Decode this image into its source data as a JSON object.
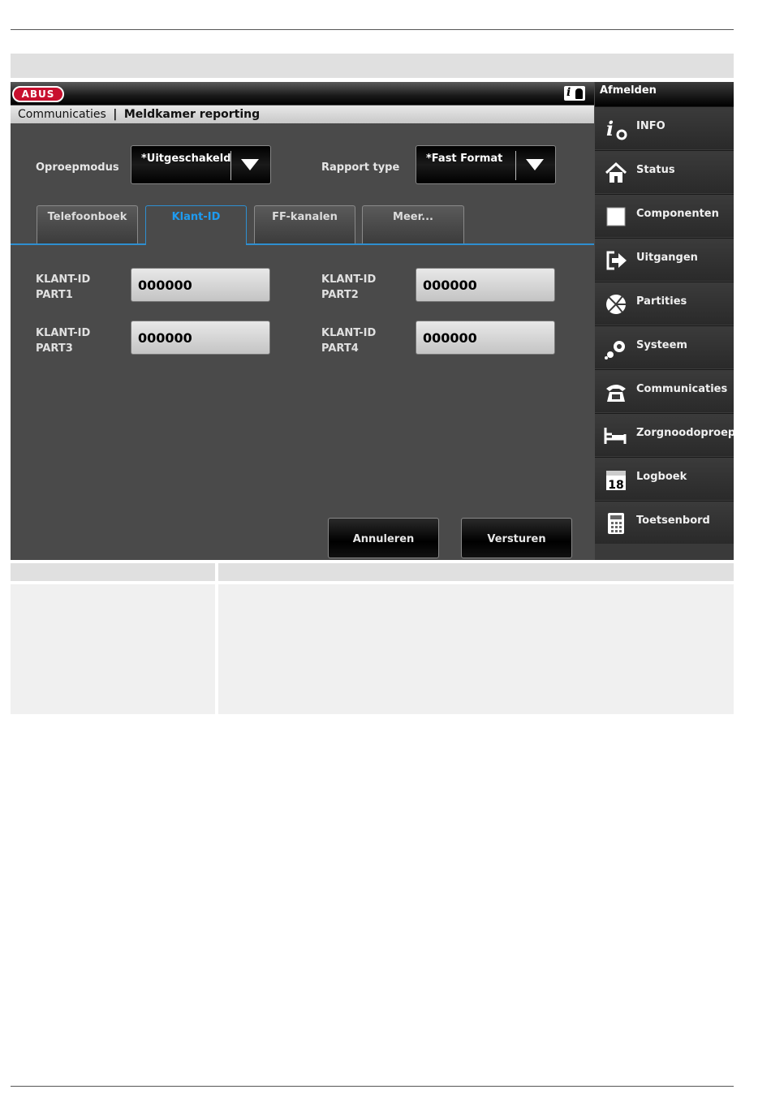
{
  "header": {
    "logo_text": "ABUS",
    "logout_label": "Afmelden"
  },
  "breadcrumb": {
    "parent": "Communicaties",
    "separator": "|",
    "current": "Meldkamer reporting"
  },
  "form": {
    "call_mode_label": "Oproepmodus",
    "call_mode_value": "*Uitgeschakeld",
    "report_type_label": "Rapport type",
    "report_type_value": "*Fast Format"
  },
  "tabs": [
    {
      "label": "Telefoonboek",
      "active": false
    },
    {
      "label": "Klant-ID",
      "active": true
    },
    {
      "label": "FF-kanalen",
      "active": false
    },
    {
      "label": "Meer...",
      "active": false
    }
  ],
  "fields": [
    {
      "label_line1": "KLANT-ID",
      "label_line2": "PART1",
      "value": "000000"
    },
    {
      "label_line1": "KLANT-ID",
      "label_line2": "PART2",
      "value": "000000"
    },
    {
      "label_line1": "KLANT-ID",
      "label_line2": "PART3",
      "value": "000000"
    },
    {
      "label_line1": "KLANT-ID",
      "label_line2": "PART4",
      "value": "000000"
    }
  ],
  "buttons": {
    "cancel": "Annuleren",
    "submit": "Versturen"
  },
  "sidebar": {
    "items": [
      {
        "label": "INFO",
        "icon": "info-settings-icon"
      },
      {
        "label": "Status",
        "icon": "home-icon"
      },
      {
        "label": "Componenten",
        "icon": "square-icon"
      },
      {
        "label": "Uitgangen",
        "icon": "exit-arrow-icon"
      },
      {
        "label": "Partities",
        "icon": "pie-icon"
      },
      {
        "label": "Systeem",
        "icon": "gears-icon"
      },
      {
        "label": "Communicaties",
        "icon": "telephone-icon"
      },
      {
        "label": "Zorgnoodoproep",
        "icon": "bed-icon"
      },
      {
        "label": "Logboek",
        "icon": "calendar-icon"
      },
      {
        "label": "Toetsenbord",
        "icon": "keypad-icon"
      }
    ],
    "calendar_day": "18"
  },
  "colors": {
    "accent": "#2e8fd0",
    "brand": "#c8102e",
    "panel": "#4a4a4a"
  }
}
